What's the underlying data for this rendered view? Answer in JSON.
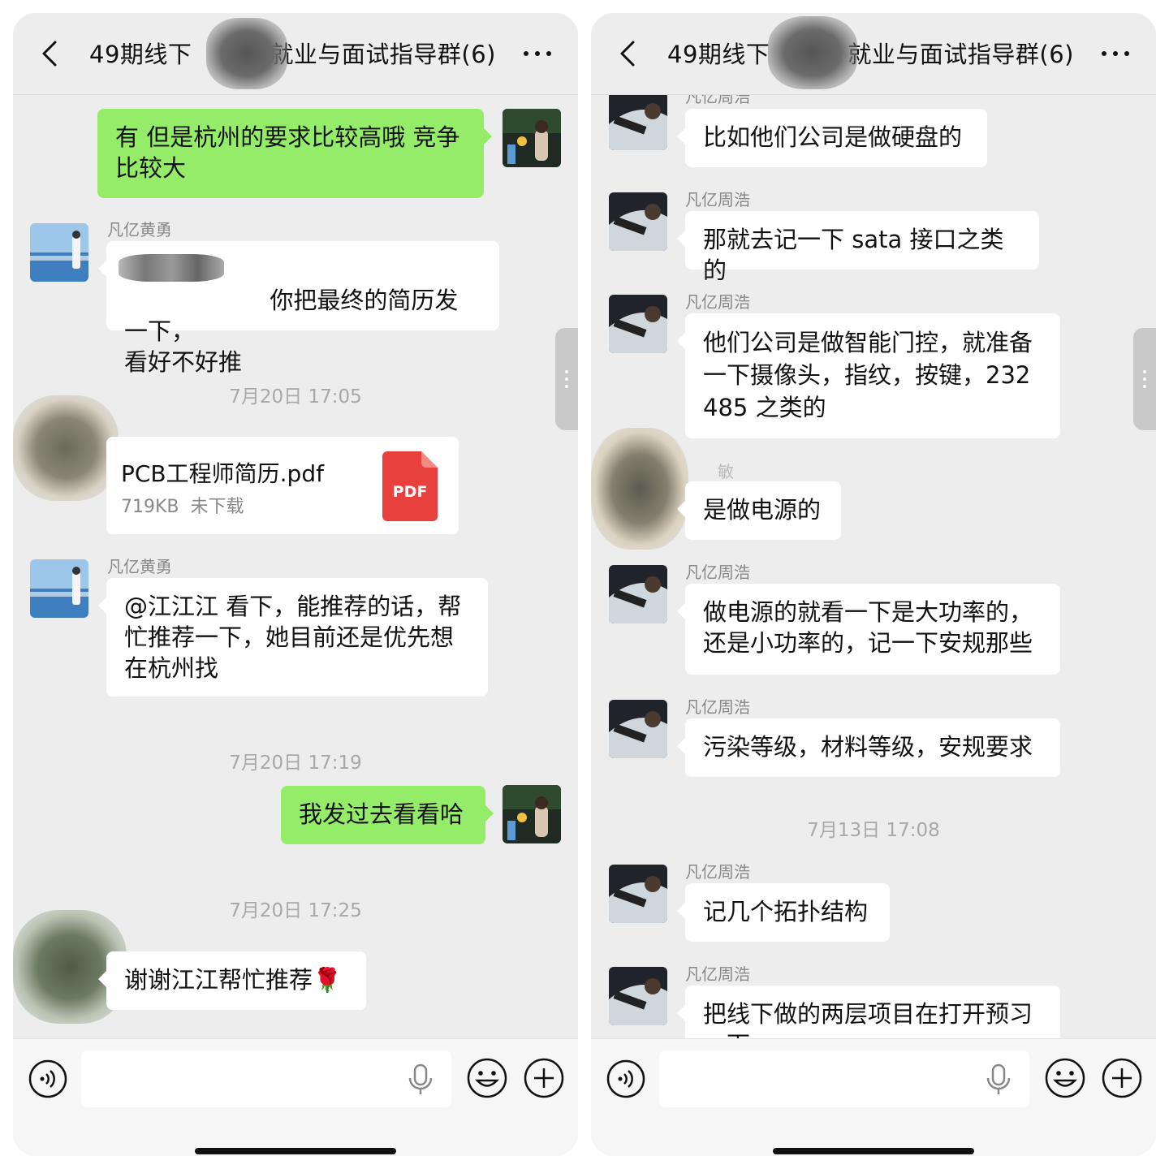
{
  "left": {
    "header": {
      "title_prefix": "49期线下",
      "title_suffix": "就业与面试指导群(6)"
    },
    "messages": {
      "m1": "有 但是杭州的要求比较高哦 竞争\n比较大",
      "m2_sender": "凡亿黄勇",
      "m2": "你把最终的简历发一下，\n看好不好推",
      "t1": "7月20日 17:05",
      "file_name": "PCB工程师简历.pdf",
      "file_size": "719KB",
      "file_status": "未下载",
      "file_badge": "PDF",
      "m3_sender": "凡亿黄勇",
      "m3": "@江江江 看下，能推荐的话，帮\n忙推荐一下，她目前还是优先想\n在杭州找",
      "t2": "7月20日 17:19",
      "m4": "我发过去看看哈",
      "t3": "7月20日 17:25",
      "m5": "谢谢江江帮忙推荐🌹"
    }
  },
  "right": {
    "header": {
      "title_prefix": "49期线下",
      "title_suffix": "就业与面试指导群(6)"
    },
    "messages": {
      "s0": "凡亿周浩",
      "m1": "比如他们公司是做硬盘的",
      "s2": "凡亿周浩",
      "m2": "那就去记一下 sata 接口之类的",
      "s3": "凡亿周浩",
      "m3": "他们公司是做智能门控，就准备\n一下摄像头，指纹，按键，232\n485 之类的",
      "s4": "敏",
      "m4": "是做电源的",
      "s5": "凡亿周浩",
      "m5": "做电源的就看一下是大功率的，\n还是小功率的，记一下安规那些",
      "s6": "凡亿周浩",
      "m6": "污染等级，材料等级，安规要求",
      "t1": "7月13日 17:08",
      "s7": "凡亿周浩",
      "m7": "记几个拓扑结构",
      "s8": "凡亿周浩",
      "m8": "把线下做的两层项目在打开预习\n一下"
    }
  },
  "colors": {
    "green_bubble": "#95ec69",
    "background": "#ededed",
    "pdf_red": "#e8413d"
  },
  "icons": [
    "back-icon",
    "more-icon",
    "voice-icon",
    "microphone-icon",
    "emoji-icon",
    "plus-icon",
    "pdf-icon"
  ]
}
